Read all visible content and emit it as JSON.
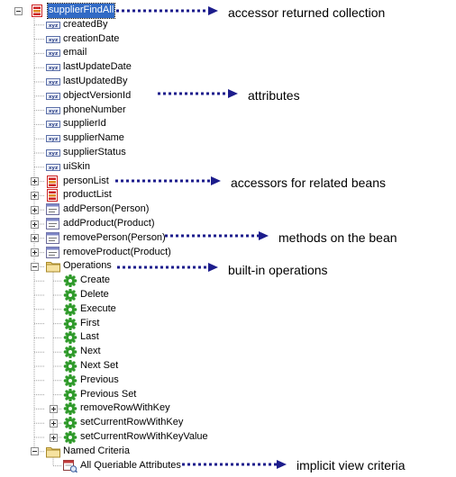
{
  "tree": {
    "root": {
      "label": "supplierFindAll",
      "icon": "collection-icon"
    },
    "attributes": [
      {
        "label": "createdBy",
        "icon": "attribute-icon"
      },
      {
        "label": "creationDate",
        "icon": "attribute-icon"
      },
      {
        "label": "email",
        "icon": "attribute-icon"
      },
      {
        "label": "lastUpdateDate",
        "icon": "attribute-icon"
      },
      {
        "label": "lastUpdatedBy",
        "icon": "attribute-icon"
      },
      {
        "label": "objectVersionId",
        "icon": "attribute-icon"
      },
      {
        "label": "phoneNumber",
        "icon": "attribute-icon"
      },
      {
        "label": "supplierId",
        "icon": "attribute-icon"
      },
      {
        "label": "supplierName",
        "icon": "attribute-icon"
      },
      {
        "label": "supplierStatus",
        "icon": "attribute-icon"
      },
      {
        "label": "uiSkin",
        "icon": "attribute-icon"
      }
    ],
    "accessors": [
      {
        "label": "personList",
        "icon": "collection-icon"
      },
      {
        "label": "productList",
        "icon": "collection-icon"
      }
    ],
    "methods": [
      {
        "label": "addPerson(Person)",
        "icon": "method-icon"
      },
      {
        "label": "addProduct(Product)",
        "icon": "method-icon"
      },
      {
        "label": "removePerson(Person)",
        "icon": "method-icon"
      },
      {
        "label": "removeProduct(Product)",
        "icon": "method-icon"
      }
    ],
    "operations_folder": {
      "label": "Operations",
      "icon": "folder-icon"
    },
    "operations": [
      {
        "label": "Create",
        "icon": "gear-icon"
      },
      {
        "label": "Delete",
        "icon": "gear-icon"
      },
      {
        "label": "Execute",
        "icon": "gear-icon"
      },
      {
        "label": "First",
        "icon": "gear-icon"
      },
      {
        "label": "Last",
        "icon": "gear-icon"
      },
      {
        "label": "Next",
        "icon": "gear-icon"
      },
      {
        "label": "Next Set",
        "icon": "gear-icon"
      },
      {
        "label": "Previous",
        "icon": "gear-icon"
      },
      {
        "label": "Previous Set",
        "icon": "gear-icon"
      },
      {
        "label": "removeRowWithKey",
        "icon": "gear-icon"
      },
      {
        "label": "setCurrentRowWithKey",
        "icon": "gear-icon"
      },
      {
        "label": "setCurrentRowWithKeyValue",
        "icon": "gear-icon"
      }
    ],
    "criteria_folder": {
      "label": "Named Criteria",
      "icon": "folder-icon"
    },
    "criteria": [
      {
        "label": "All Queriable Attributes",
        "icon": "view-criteria-icon"
      }
    ]
  },
  "annotations": [
    {
      "id": "a1",
      "text": "accessor returned collection"
    },
    {
      "id": "a2",
      "text": "attributes"
    },
    {
      "id": "a3",
      "text": "accessors for related beans"
    },
    {
      "id": "a4",
      "text": "methods on the bean"
    },
    {
      "id": "a5",
      "text": "built-in operations"
    },
    {
      "id": "a6",
      "text": "implicit view criteria"
    }
  ],
  "colors": {
    "selection": "#316ac5",
    "annotation_arrow": "#1c1c8c",
    "gear": "#2f9a2a",
    "collection": "#cc2222",
    "folder": "#f0d27a",
    "tree_line": "#a0a0a0"
  }
}
